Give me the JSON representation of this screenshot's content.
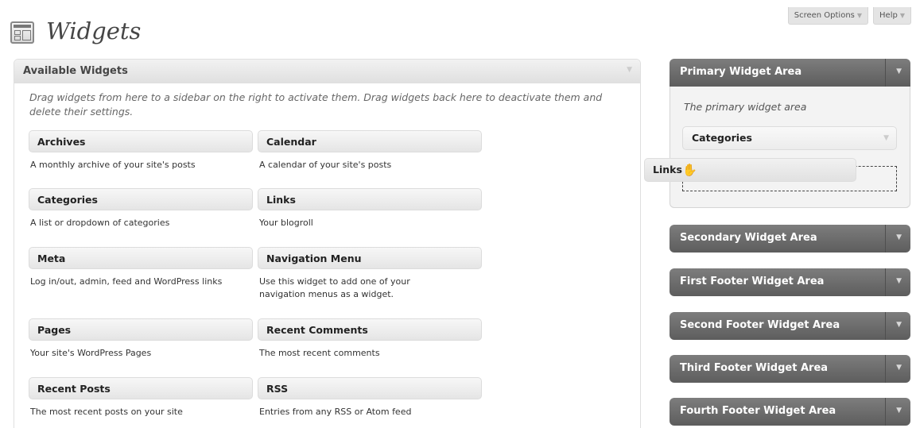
{
  "screen_meta": {
    "screen_options": "Screen Options",
    "help": "Help"
  },
  "page_title": "Widgets",
  "available": {
    "title": "Available Widgets",
    "description": "Drag widgets from here to a sidebar on the right to activate them. Drag widgets back here to deactivate them and delete their settings.",
    "widgets": [
      {
        "name": "Archives",
        "desc": "A monthly archive of your site's posts"
      },
      {
        "name": "Calendar",
        "desc": "A calendar of your site's posts"
      },
      {
        "name": "Categories",
        "desc": "A list or dropdown of categories"
      },
      {
        "name": "Links",
        "desc": "Your blogroll"
      },
      {
        "name": "Meta",
        "desc": "Log in/out, admin, feed and WordPress links"
      },
      {
        "name": "Navigation Menu",
        "desc": "Use this widget to add one of your navigation menus as a widget."
      },
      {
        "name": "Pages",
        "desc": "Your site's WordPress Pages"
      },
      {
        "name": "Recent Comments",
        "desc": "The most recent comments"
      },
      {
        "name": "Recent Posts",
        "desc": "The most recent posts on your site"
      },
      {
        "name": "RSS",
        "desc": "Entries from any RSS or Atom feed"
      }
    ]
  },
  "sidebars": {
    "primary": {
      "title": "Primary Widget Area",
      "description": "The primary widget area",
      "widget": "Categories"
    },
    "others": [
      "Secondary Widget Area",
      "First Footer Widget Area",
      "Second Footer Widget Area",
      "Third Footer Widget Area",
      "Fourth Footer Widget Area"
    ]
  },
  "dragging_widget": "Links",
  "icons": {
    "dropdown": "triangle-down-icon",
    "cursor": "grab-hand-icon",
    "page": "widgets-icon"
  }
}
